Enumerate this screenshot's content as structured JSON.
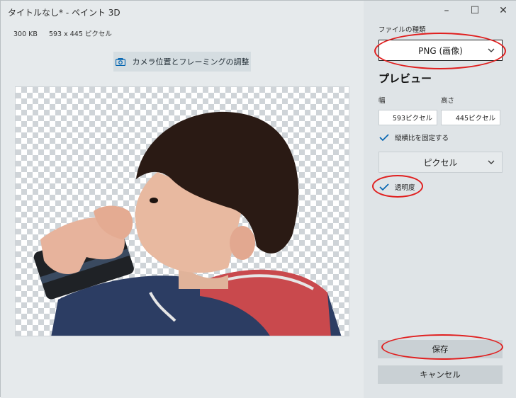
{
  "window": {
    "title": "タイトルなし* - ペイント 3D",
    "minimize": "–",
    "maximize": "☐",
    "close": "✕"
  },
  "info": {
    "file_size": "300 KB",
    "dimensions": "593 x 445 ピクセル"
  },
  "camera_button": {
    "label": "カメラ位置とフレーミングの調整",
    "icon": "camera-icon"
  },
  "export_panel": {
    "file_type_label": "ファイルの種類",
    "file_type_value": "PNG (画像)",
    "preview_heading": "プレビュー",
    "width_label": "幅",
    "height_label": "高さ",
    "width_value": "593ピクセル",
    "height_value": "445ピクセル",
    "lock_aspect_label": "縦横比を固定する",
    "lock_aspect_checked": true,
    "unit_value": "ピクセル",
    "transparency_label": "透明度",
    "transparency_checked": true,
    "save_label": "保存",
    "cancel_label": "キャンセル"
  },
  "colors": {
    "accent": "#0063b1",
    "annotation": "#e01f1f"
  }
}
